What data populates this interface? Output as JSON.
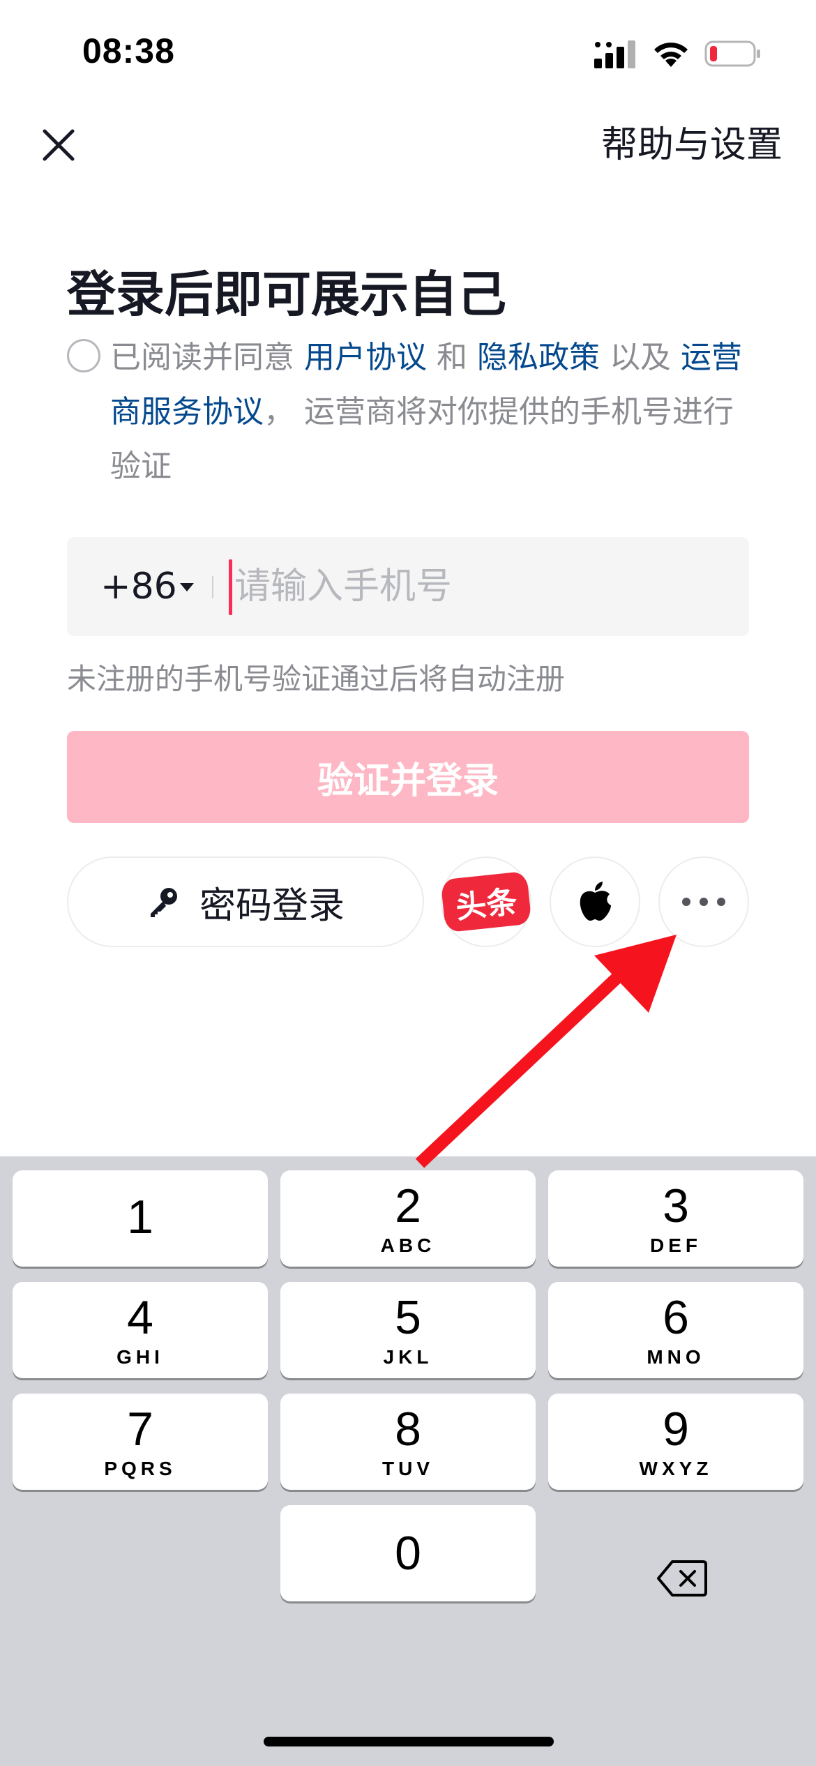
{
  "status_bar": {
    "time": "08:38"
  },
  "header": {
    "help_label": "帮助与设置"
  },
  "title": "登录后即可展示自己",
  "agreement": {
    "prefix": "已阅读并同意 ",
    "user_agreement": "用户协议",
    "and": " 和 ",
    "privacy_policy": "隐私政策",
    "as_well_as": " 以及 ",
    "carrier_agreement": "运营商服务协议",
    "suffix": "， 运营商将对你提供的手机号进行验证"
  },
  "phone": {
    "country_code": "+86",
    "placeholder": "请输入手机号"
  },
  "hint": "未注册的手机号验证通过后将自动注册",
  "login_button": "验证并登录",
  "alt_login": {
    "password_label": "密码登录",
    "toutiao_label": "头条"
  },
  "colors": {
    "accent": "#fe2c55",
    "button_disabled": "#feb8c5",
    "link": "#04498d",
    "arrow": "#f5141e"
  },
  "keyboard": {
    "keys": [
      {
        "digit": "1",
        "letters": ""
      },
      {
        "digit": "2",
        "letters": "ABC"
      },
      {
        "digit": "3",
        "letters": "DEF"
      },
      {
        "digit": "4",
        "letters": "GHI"
      },
      {
        "digit": "5",
        "letters": "JKL"
      },
      {
        "digit": "6",
        "letters": "MNO"
      },
      {
        "digit": "7",
        "letters": "PQRS"
      },
      {
        "digit": "8",
        "letters": "TUV"
      },
      {
        "digit": "9",
        "letters": "WXYZ"
      },
      {
        "digit": "0",
        "letters": ""
      }
    ]
  }
}
